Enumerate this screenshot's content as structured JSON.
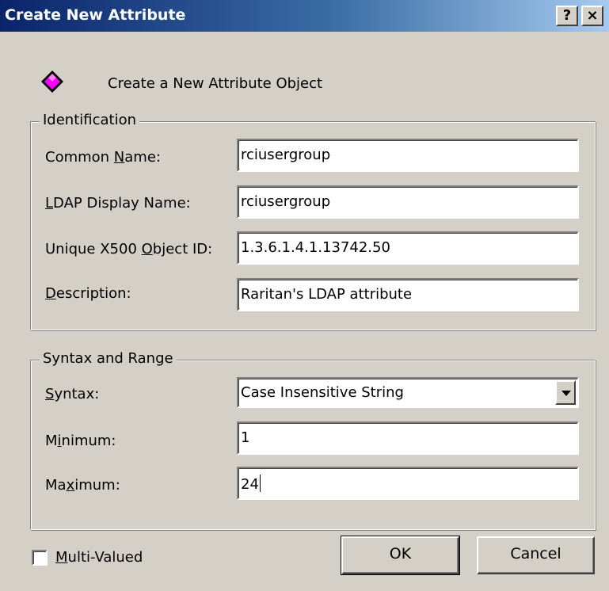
{
  "window": {
    "title": "Create New Attribute",
    "help_label": "?",
    "close_label": "×"
  },
  "header": {
    "icon": "attribute-object-icon",
    "text": "Create a New Attribute Object"
  },
  "identification": {
    "legend": "Identification",
    "common_name": {
      "label_pre": "Common ",
      "label_key": "N",
      "label_post": "ame:",
      "value": "rciusergroup"
    },
    "ldap_display_name": {
      "label_pre": "",
      "label_key": "L",
      "label_post": "DAP Display Name:",
      "value": "rciusergroup"
    },
    "object_id": {
      "label_pre": "Unique X500 ",
      "label_key": "O",
      "label_post": "bject ID:",
      "value": "1.3.6.1.4.1.13742.50"
    },
    "description": {
      "label_pre": "",
      "label_key": "D",
      "label_post": "escription:",
      "value": "Raritan's LDAP attribute"
    }
  },
  "syntax_range": {
    "legend": "Syntax and Range",
    "syntax": {
      "label_pre": "",
      "label_key": "S",
      "label_post": "yntax:",
      "value": "Case Insensitive String"
    },
    "minimum": {
      "label_pre": "M",
      "label_key": "i",
      "label_post": "nimum:",
      "value": "1"
    },
    "maximum": {
      "label_pre": "Ma",
      "label_key": "x",
      "label_post": "imum:",
      "value": "24"
    }
  },
  "footer": {
    "multivalued": {
      "label_pre": "",
      "label_key": "M",
      "label_post": "ulti-Valued",
      "checked": false
    },
    "ok_label": "OK",
    "cancel_label": "Cancel"
  },
  "colors": {
    "titlebar_start": "#0a246a",
    "titlebar_end": "#a6caf0",
    "face": "#d4d0c8",
    "icon_fill": "#ff00ff"
  }
}
